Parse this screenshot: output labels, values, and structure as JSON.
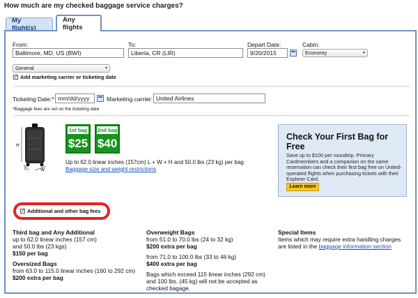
{
  "page": {
    "title": "How much are my checked baggage service charges?"
  },
  "tabs": [
    {
      "label": "My flight(s)",
      "active": false
    },
    {
      "label": "Any flights",
      "active": true
    }
  ],
  "search": {
    "from_label": "From:",
    "from_value": "Baltimore, MD, US (BWI)",
    "to_label": "To:",
    "to_value": "Liberia, CR (LIR)",
    "depart_label": "Depart Date:",
    "depart_value": "9/20/2015",
    "cabin_label": "Cabin:",
    "cabin_value": "Economy",
    "type_value": "General",
    "marketing_check_label": "Add marketing carrier or ticketing date",
    "ticketing_label": "Ticketing Date:*",
    "ticketing_placeholder": "mm/dd/yyyy",
    "carrier_label": "Marketing carrier:",
    "carrier_value": "United Airlines",
    "footnote": "*Baggage fees are set on the ticketing date"
  },
  "bag_fees": {
    "first_label": "1st bag",
    "first_price": "$25",
    "second_label": "2nd bag",
    "second_price": "$40",
    "dimension_text": "Up to 62.0 linear inches (157cm) L + W + H and 50.0 lbs (23 kg) per bag",
    "size_link": "Baggage size and weight restrictions",
    "dim_h": "H",
    "dim_l": "L",
    "dim_w": "W"
  },
  "promo": {
    "title": "Check Your First Bag for Free",
    "body": "Save up to $100 per roundtrip. Primary Cardmembers and a companion on the same reservation can check their first bag free on United-operated flights when purchasing tickets with their Explorer Card.",
    "button": "Learn more"
  },
  "additional": {
    "checkbox_label": "Additional and other bag fees"
  },
  "columns": {
    "third": {
      "heading": "Third bag and Any Additional",
      "line1": "up to 62.0 linear inches (157 cm)",
      "line2": "and 50.0 lbs (23 kgs)",
      "price": "$150 per bag"
    },
    "oversized": {
      "heading": "Oversized Bags",
      "line1": "from 63.0 to 115.0 linear inches (160 to 292 cm)",
      "price": "$200 extra per bag"
    },
    "overweight": {
      "heading": "Overweight Bags",
      "line1": "from 51.0 to 70.0 lbs (24 to 32 kg)",
      "price1": "$200 extra per bag",
      "line2": "from 71.0 to 100.0 lbs (33 to 46 kg)",
      "price2": "$400 extra per bag",
      "note": "Bags which exceed 115 linear inches (292 cm) and 100 lbs. (45 kg) will not be accepted as checked bagage."
    },
    "special": {
      "heading": "Special Items",
      "text": "Items which may require extra handling charges are listed in the",
      "link": "baggage information section"
    }
  }
}
